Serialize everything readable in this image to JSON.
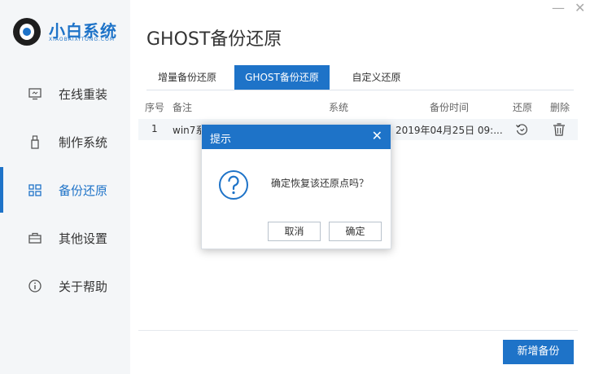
{
  "app": {
    "logo_title": "小白系统",
    "logo_subtitle": "XIAOBAIXITONG.COM"
  },
  "window_controls": {
    "minimize": "—",
    "close": "✕"
  },
  "sidebar": {
    "items": [
      {
        "label": "在线重装",
        "icon": "monitor-icon"
      },
      {
        "label": "制作系统",
        "icon": "usb-icon"
      },
      {
        "label": "备份还原",
        "icon": "grid-icon",
        "active": true
      },
      {
        "label": "其他设置",
        "icon": "briefcase-icon"
      },
      {
        "label": "关于帮助",
        "icon": "info-icon"
      }
    ]
  },
  "page_title": "GHOST备份还原",
  "tabs": [
    {
      "label": "增量备份还原"
    },
    {
      "label": "GHOST备份还原",
      "active": true
    },
    {
      "label": "自定义还原"
    }
  ],
  "table": {
    "headers": [
      "序号",
      "备注",
      "系统",
      "备份时间",
      "还原",
      "删除"
    ],
    "rows": [
      {
        "index": "1",
        "note": "win7系",
        "time": "2019年04月25日 09:...",
        "restore_icon": "restore-icon",
        "delete_icon": "trash-icon"
      }
    ]
  },
  "add_backup_button": "新增备份",
  "dialog": {
    "title": "提示",
    "close": "✕",
    "icon": "question-icon",
    "message": "确定恢复该还原点吗？",
    "cancel": "取消",
    "confirm": "确定"
  },
  "colors": {
    "accent": "#1e73c8",
    "sidebar_bg": "#f4f6f8"
  }
}
